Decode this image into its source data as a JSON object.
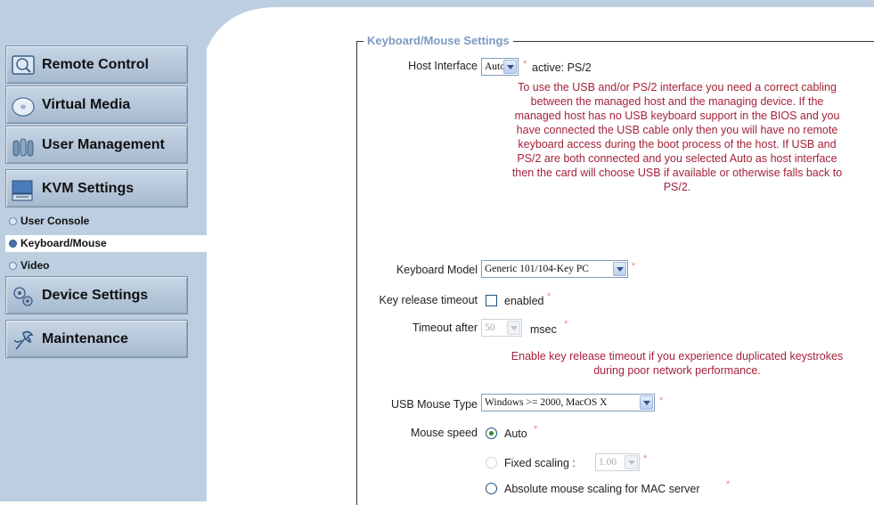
{
  "sidebar": {
    "buttons": [
      {
        "label": "Remote Control",
        "icon": "monitor-icon"
      },
      {
        "label": "Virtual Media",
        "icon": "disc-icon"
      },
      {
        "label": "User Management",
        "icon": "users-icon"
      },
      {
        "label": "KVM Settings",
        "icon": "keyboard-icon"
      },
      {
        "label": "Device Settings",
        "icon": "gears-icon"
      },
      {
        "label": "Maintenance",
        "icon": "wrench-icon"
      }
    ],
    "sub_items": [
      {
        "label": "User Console",
        "active": false
      },
      {
        "label": "Keyboard/Mouse",
        "active": true
      },
      {
        "label": "Video",
        "active": false
      }
    ]
  },
  "section_title": "Keyboard/Mouse Settings",
  "host_interface": {
    "label": "Host Interface",
    "value": "Auto",
    "required": "*",
    "active_text": "active: PS/2",
    "note_lines": [
      "To use the USB and/or PS/2 interface you need a correct cabling",
      "between the managed host and the managing device. If the",
      "managed host has no USB keyboard support in the BIOS and you",
      "have connected the USB cable only then you will have no remote",
      "keyboard access during the boot process of the host. If USB and",
      "PS/2 are both connected and you selected Auto as host interface",
      "then the card will choose USB if available or otherwise falls back to",
      "PS/2."
    ]
  },
  "keyboard_model": {
    "label": "Keyboard Model",
    "value": "Generic 101/104-Key PC",
    "required": "*"
  },
  "key_release_timeout": {
    "label": "Key release timeout",
    "checkbox_label": "enabled",
    "checked": false,
    "required": "*"
  },
  "timeout_after": {
    "label": "Timeout after",
    "value": "50",
    "unit": "msec",
    "required": "*",
    "note_lines": [
      "Enable key release timeout if you experience duplicated keystrokes",
      "during poor network performance."
    ]
  },
  "usb_mouse_type": {
    "label": "USB Mouse Type",
    "value": "Windows >= 2000, MacOS X",
    "required": "*"
  },
  "mouse_speed": {
    "label": "Mouse speed",
    "options": [
      {
        "label": "Auto",
        "checked": true,
        "disabled": false
      },
      {
        "label": "Fixed scaling :",
        "checked": false,
        "disabled": true
      },
      {
        "label": "Absolute mouse scaling for MAC server",
        "checked": false,
        "disabled": false
      }
    ],
    "fixed_scaling_value": "1.00",
    "required": "*"
  },
  "colors": {
    "sidebar": "#bccee0",
    "note": "#a5223a",
    "legend": "#7c9bc2"
  }
}
